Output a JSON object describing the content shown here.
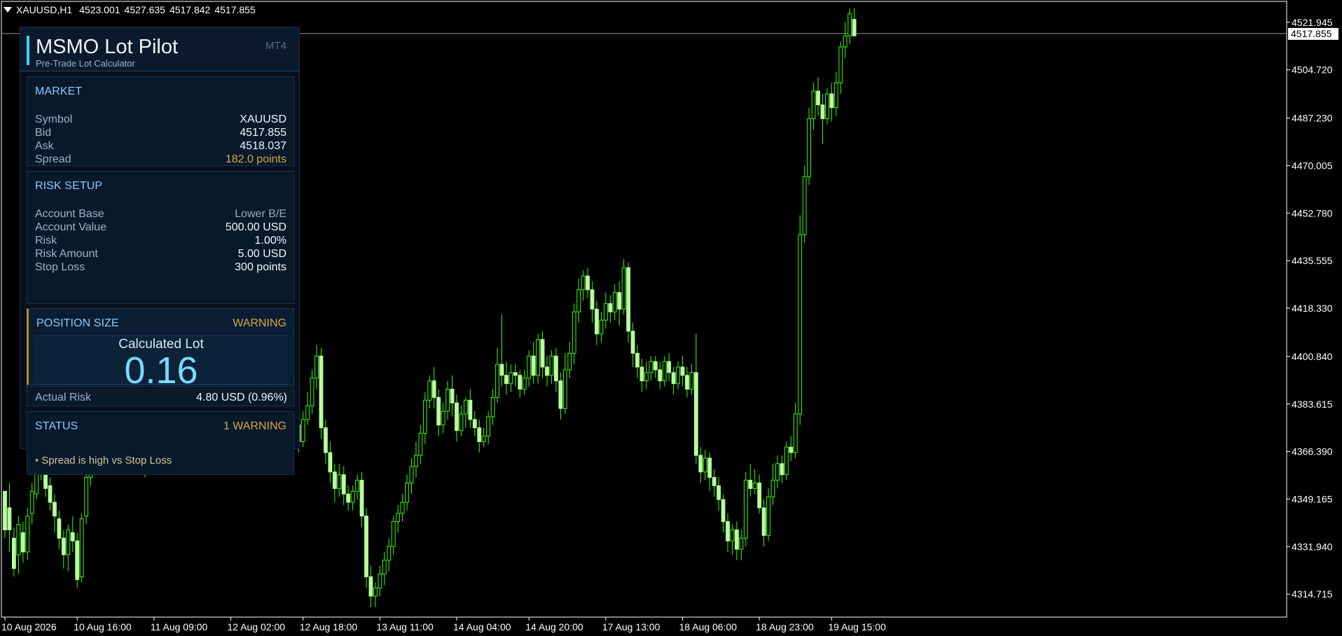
{
  "window": {
    "symbol_timeframe": "XAUUSD,H1",
    "quote_open": "4523.001",
    "quote_high": "4527.635",
    "quote_low": "4517.842",
    "quote_close": "4517.855"
  },
  "panel": {
    "title": "MSMO Lot Pilot",
    "subtitle": "Pre-Trade Lot Calculator",
    "badge": "MT4",
    "market": {
      "title": "MARKET",
      "symbol_label": "Symbol",
      "symbol_value": "XAUUSD",
      "bid_label": "Bid",
      "bid_value": "4517.855",
      "ask_label": "Ask",
      "ask_value": "4518.037",
      "spread_label": "Spread",
      "spread_value": "182.0 points"
    },
    "risk_setup": {
      "title": "RISK SETUP",
      "account_base_label": "Account Base",
      "account_base_value": "Lower B/E",
      "account_value_label": "Account Value",
      "account_value_value": "500.00 USD",
      "risk_label": "Risk",
      "risk_value": "1.00%",
      "risk_amount_label": "Risk Amount",
      "risk_amount_value": "5.00 USD",
      "stop_loss_label": "Stop Loss",
      "stop_loss_value": "300 points"
    },
    "position_size": {
      "title": "POSITION SIZE",
      "status": "WARNING",
      "calculated_lot_label": "Calculated Lot",
      "calculated_lot_value": "0.16"
    },
    "actual_risk": {
      "label": "Actual Risk",
      "value": "4.80 USD (0.96%)"
    },
    "status": {
      "title": "STATUS",
      "summary": "1 WARNING",
      "message": "Spread is high vs Stop Loss"
    }
  },
  "chart_data": {
    "type": "candlestick",
    "title": "",
    "xlabel": "",
    "ylabel": "",
    "ylim": [
      4306.4,
      4529.5
    ],
    "grid": false,
    "current_price": "4517.855",
    "price_ticks": [
      "4521.945",
      "4504.720",
      "4487.230",
      "4470.005",
      "4452.780",
      "4435.555",
      "4418.330",
      "4400.840",
      "4383.615",
      "4366.390",
      "4349.165",
      "4331.940",
      "4314.715"
    ],
    "price_tick_values": [
      4521.945,
      4504.72,
      4487.23,
      4470.005,
      4452.78,
      4435.555,
      4418.33,
      4400.84,
      4383.615,
      4366.39,
      4349.165,
      4331.94,
      4314.715
    ],
    "x_ticks": [
      "10 Aug 2026",
      "10 Aug 16:00",
      "11 Aug 09:00",
      "12 Aug 02:00",
      "12 Aug 18:00",
      "13 Aug 11:00",
      "14 Aug 04:00",
      "14 Aug 20:00",
      "17 Aug 13:00",
      "18 Aug 06:00",
      "18 Aug 23:00",
      "19 Aug 15:00"
    ],
    "x_tick_positions": [
      0,
      16,
      33,
      50,
      66,
      83,
      100,
      116,
      133,
      150,
      167,
      183
    ],
    "candles": [
      [
        4352,
        4338,
        4348,
        4335
      ],
      [
        4346,
        4338,
        4355,
        4330
      ],
      [
        4335,
        4324,
        4339,
        4321
      ],
      [
        4329,
        4340,
        4343,
        4322
      ],
      [
        4337,
        4330,
        4341,
        4326
      ],
      [
        4330,
        4343,
        4346,
        4327
      ],
      [
        4344,
        4352,
        4355,
        4340
      ],
      [
        4351,
        4363,
        4366,
        4349
      ],
      [
        4364,
        4360,
        4370,
        4356
      ],
      [
        4360,
        4353,
        4363,
        4350
      ],
      [
        4354,
        4348,
        4357,
        4345
      ],
      [
        4348,
        4343,
        4351,
        4337
      ],
      [
        4342,
        4335,
        4345,
        4331
      ],
      [
        4335,
        4329,
        4338,
        4324
      ],
      [
        4329,
        4338,
        4340,
        4323
      ],
      [
        4337,
        4334,
        4343,
        4330
      ],
      [
        4334,
        4320,
        4337,
        4317
      ],
      [
        4321,
        4342,
        4344,
        4319
      ],
      [
        4343,
        4357,
        4360,
        4340
      ],
      [
        4357,
        4364,
        4368,
        4354
      ],
      [
        4364,
        4368,
        4373,
        4361
      ],
      [
        4368,
        4372,
        4375,
        4365
      ],
      [
        4373,
        4374,
        4377,
        4369
      ],
      [
        4374,
        4369,
        4378,
        4366
      ],
      [
        4369,
        4370,
        4372,
        4365
      ],
      [
        4370,
        4373,
        4375,
        4368
      ],
      [
        4373,
        4375,
        4377,
        4370
      ],
      [
        4375,
        4373,
        4377,
        4371
      ],
      [
        4373,
        4374,
        4376,
        4370
      ],
      [
        4374,
        4371,
        4375,
        4368
      ],
      [
        4371,
        4368,
        4374,
        4364
      ],
      [
        4368,
        4360,
        4369,
        4357
      ],
      [
        4360,
        4368,
        4371,
        4358
      ],
      [
        4368,
        4370,
        4372,
        4365
      ],
      [
        4370,
        4372,
        4374,
        4367
      ],
      [
        4372,
        4371,
        4374,
        4368
      ],
      [
        4371,
        4367,
        4372,
        4364
      ],
      [
        4367,
        4369,
        4371,
        4365
      ],
      [
        4369,
        4372,
        4373,
        4367
      ],
      [
        4372,
        4370,
        4373,
        4368
      ],
      [
        4370,
        4366,
        4371,
        4364
      ],
      [
        4366,
        4371,
        4372,
        4365
      ],
      [
        4371,
        4369,
        4373,
        4367
      ],
      [
        4369,
        4372,
        4374,
        4367
      ],
      [
        4372,
        4401,
        4404,
        4370
      ],
      [
        4401,
        4405,
        4408,
        4398
      ],
      [
        4405,
        4415,
        4418,
        4402
      ],
      [
        4415,
        4413,
        4422,
        4409
      ],
      [
        4413,
        4436,
        4441,
        4410
      ],
      [
        4436,
        4431,
        4442,
        4425
      ],
      [
        4431,
        4424,
        4435,
        4420
      ],
      [
        4424,
        4413,
        4426,
        4408
      ],
      [
        4413,
        4403,
        4415,
        4399
      ],
      [
        4403,
        4411,
        4417,
        4400
      ],
      [
        4411,
        4407,
        4414,
        4403
      ],
      [
        4407,
        4401,
        4410,
        4396
      ],
      [
        4401,
        4412,
        4415,
        4399
      ],
      [
        4412,
        4402,
        4418,
        4398
      ],
      [
        4402,
        4432,
        4450,
        4399
      ],
      [
        4432,
        4419,
        4437,
        4415
      ],
      [
        4419,
        4407,
        4422,
        4404
      ],
      [
        4407,
        4402,
        4410,
        4397
      ],
      [
        4402,
        4398,
        4404,
        4393
      ],
      [
        4398,
        4389,
        4400,
        4380
      ],
      [
        4389,
        4376,
        4391,
        4372
      ],
      [
        4376,
        4370,
        4380,
        4366
      ],
      [
        4370,
        4378,
        4381,
        4368
      ],
      [
        4378,
        4383,
        4388,
        4376
      ],
      [
        4383,
        4393,
        4396,
        4380
      ],
      [
        4393,
        4401,
        4405,
        4389
      ],
      [
        4401,
        4375,
        4404,
        4371
      ],
      [
        4375,
        4366,
        4378,
        4362
      ],
      [
        4366,
        4359,
        4370,
        4355
      ],
      [
        4359,
        4353,
        4362,
        4348
      ],
      [
        4353,
        4358,
        4362,
        4350
      ],
      [
        4358,
        4351,
        4361,
        4347
      ],
      [
        4351,
        4348,
        4354,
        4345
      ],
      [
        4348,
        4352,
        4354,
        4345
      ],
      [
        4352,
        4356,
        4358,
        4349
      ],
      [
        4356,
        4343,
        4359,
        4339
      ],
      [
        4343,
        4321,
        4346,
        4317
      ],
      [
        4321,
        4314,
        4325,
        4310
      ],
      [
        4314,
        4317,
        4319,
        4310
      ],
      [
        4317,
        4322,
        4325,
        4314
      ],
      [
        4322,
        4327,
        4330,
        4318
      ],
      [
        4327,
        4332,
        4335,
        4323
      ],
      [
        4332,
        4341,
        4343,
        4329
      ],
      [
        4341,
        4344,
        4347,
        4337
      ],
      [
        4344,
        4348,
        4351,
        4341
      ],
      [
        4348,
        4355,
        4358,
        4345
      ],
      [
        4355,
        4361,
        4364,
        4351
      ],
      [
        4361,
        4365,
        4370,
        4357
      ],
      [
        4365,
        4373,
        4376,
        4362
      ],
      [
        4373,
        4385,
        4388,
        4369
      ],
      [
        4385,
        4392,
        4394,
        4382
      ],
      [
        4392,
        4386,
        4397,
        4382
      ],
      [
        4386,
        4376,
        4389,
        4372
      ],
      [
        4376,
        4381,
        4384,
        4373
      ],
      [
        4381,
        4389,
        4392,
        4378
      ],
      [
        4389,
        4384,
        4394,
        4379
      ],
      [
        4384,
        4374,
        4387,
        4370
      ],
      [
        4374,
        4380,
        4383,
        4372
      ],
      [
        4380,
        4385,
        4386,
        4375
      ],
      [
        4385,
        4378,
        4389,
        4375
      ],
      [
        4378,
        4375,
        4381,
        4372
      ],
      [
        4375,
        4370,
        4378,
        4366
      ],
      [
        4370,
        4372,
        4375,
        4368
      ],
      [
        4372,
        4379,
        4381,
        4369
      ],
      [
        4379,
        4386,
        4389,
        4376
      ],
      [
        4386,
        4398,
        4404,
        4384
      ],
      [
        4398,
        4394,
        4416,
        4390
      ],
      [
        4394,
        4391,
        4399,
        4387
      ],
      [
        4391,
        4395,
        4398,
        4388
      ],
      [
        4395,
        4394,
        4398,
        4390
      ],
      [
        4394,
        4389,
        4396,
        4386
      ],
      [
        4389,
        4393,
        4396,
        4387
      ],
      [
        4393,
        4401,
        4403,
        4390
      ],
      [
        4401,
        4394,
        4406,
        4391
      ],
      [
        4394,
        4407,
        4409,
        4391
      ],
      [
        4407,
        4397,
        4410,
        4393
      ],
      [
        4397,
        4394,
        4401,
        4390
      ],
      [
        4394,
        4401,
        4403,
        4391
      ],
      [
        4401,
        4392,
        4404,
        4388
      ],
      [
        4392,
        4382,
        4395,
        4378
      ],
      [
        4382,
        4396,
        4402,
        4380
      ],
      [
        4396,
        4402,
        4406,
        4393
      ],
      [
        4402,
        4417,
        4420,
        4398
      ],
      [
        4417,
        4425,
        4429,
        4413
      ],
      [
        4425,
        4430,
        4432,
        4421
      ],
      [
        4430,
        4425,
        4433,
        4422
      ],
      [
        4425,
        4418,
        4428,
        4413
      ],
      [
        4418,
        4409,
        4421,
        4405
      ],
      [
        4409,
        4414,
        4417,
        4406
      ],
      [
        4414,
        4420,
        4424,
        4411
      ],
      [
        4420,
        4417,
        4423,
        4413
      ],
      [
        4417,
        4424,
        4427,
        4414
      ],
      [
        4424,
        4418,
        4428,
        4412
      ],
      [
        4418,
        4433,
        4436,
        4416
      ],
      [
        4433,
        4410,
        4435,
        4406
      ],
      [
        4410,
        4402,
        4413,
        4397
      ],
      [
        4402,
        4397,
        4405,
        4393
      ],
      [
        4397,
        4392,
        4400,
        4388
      ],
      [
        4392,
        4395,
        4399,
        4389
      ],
      [
        4395,
        4399,
        4401,
        4392
      ],
      [
        4399,
        4396,
        4401,
        4393
      ],
      [
        4396,
        4392,
        4399,
        4389
      ],
      [
        4392,
        4399,
        4401,
        4390
      ],
      [
        4399,
        4395,
        4402,
        4392
      ],
      [
        4395,
        4391,
        4397,
        4387
      ],
      [
        4391,
        4397,
        4399,
        4389
      ],
      [
        4397,
        4394,
        4401,
        4390
      ],
      [
        4394,
        4389,
        4397,
        4386
      ],
      [
        4389,
        4395,
        4398,
        4387
      ],
      [
        4395,
        4365,
        4409,
        4362
      ],
      [
        4365,
        4359,
        4368,
        4355
      ],
      [
        4359,
        4364,
        4367,
        4356
      ],
      [
        4364,
        4357,
        4366,
        4352
      ],
      [
        4357,
        4354,
        4360,
        4350
      ],
      [
        4354,
        4349,
        4357,
        4345
      ],
      [
        4349,
        4341,
        4351,
        4337
      ],
      [
        4341,
        4334,
        4344,
        4330
      ],
      [
        4334,
        4338,
        4340,
        4329
      ],
      [
        4338,
        4331,
        4341,
        4327
      ],
      [
        4331,
        4335,
        4338,
        4327
      ],
      [
        4335,
        4356,
        4359,
        4332
      ],
      [
        4356,
        4353,
        4362,
        4350
      ],
      [
        4353,
        4355,
        4360,
        4351
      ],
      [
        4355,
        4346,
        4358,
        4344
      ],
      [
        4346,
        4336,
        4349,
        4332
      ],
      [
        4336,
        4350,
        4353,
        4334
      ],
      [
        4350,
        4356,
        4362,
        4347
      ],
      [
        4356,
        4362,
        4365,
        4353
      ],
      [
        4362,
        4358,
        4365,
        4355
      ],
      [
        4358,
        4368,
        4370,
        4356
      ],
      [
        4368,
        4366,
        4372,
        4363
      ],
      [
        4366,
        4380,
        4384,
        4364
      ],
      [
        4380,
        4445,
        4452,
        4376
      ],
      [
        4445,
        4466,
        4470,
        4442
      ],
      [
        4466,
        4487,
        4491,
        4463
      ],
      [
        4487,
        4497,
        4500,
        4483
      ],
      [
        4497,
        4492,
        4502,
        4488
      ],
      [
        4492,
        4487,
        4496,
        4478
      ],
      [
        4487,
        4496,
        4498,
        4485
      ],
      [
        4496,
        4491,
        4500,
        4486
      ],
      [
        4491,
        4500,
        4504,
        4488
      ],
      [
        4500,
        4513,
        4515,
        4496
      ],
      [
        4513,
        4517,
        4522,
        4509
      ],
      [
        4517,
        4525,
        4527,
        4514
      ],
      [
        4523,
        4517,
        4527,
        4517
      ]
    ]
  }
}
